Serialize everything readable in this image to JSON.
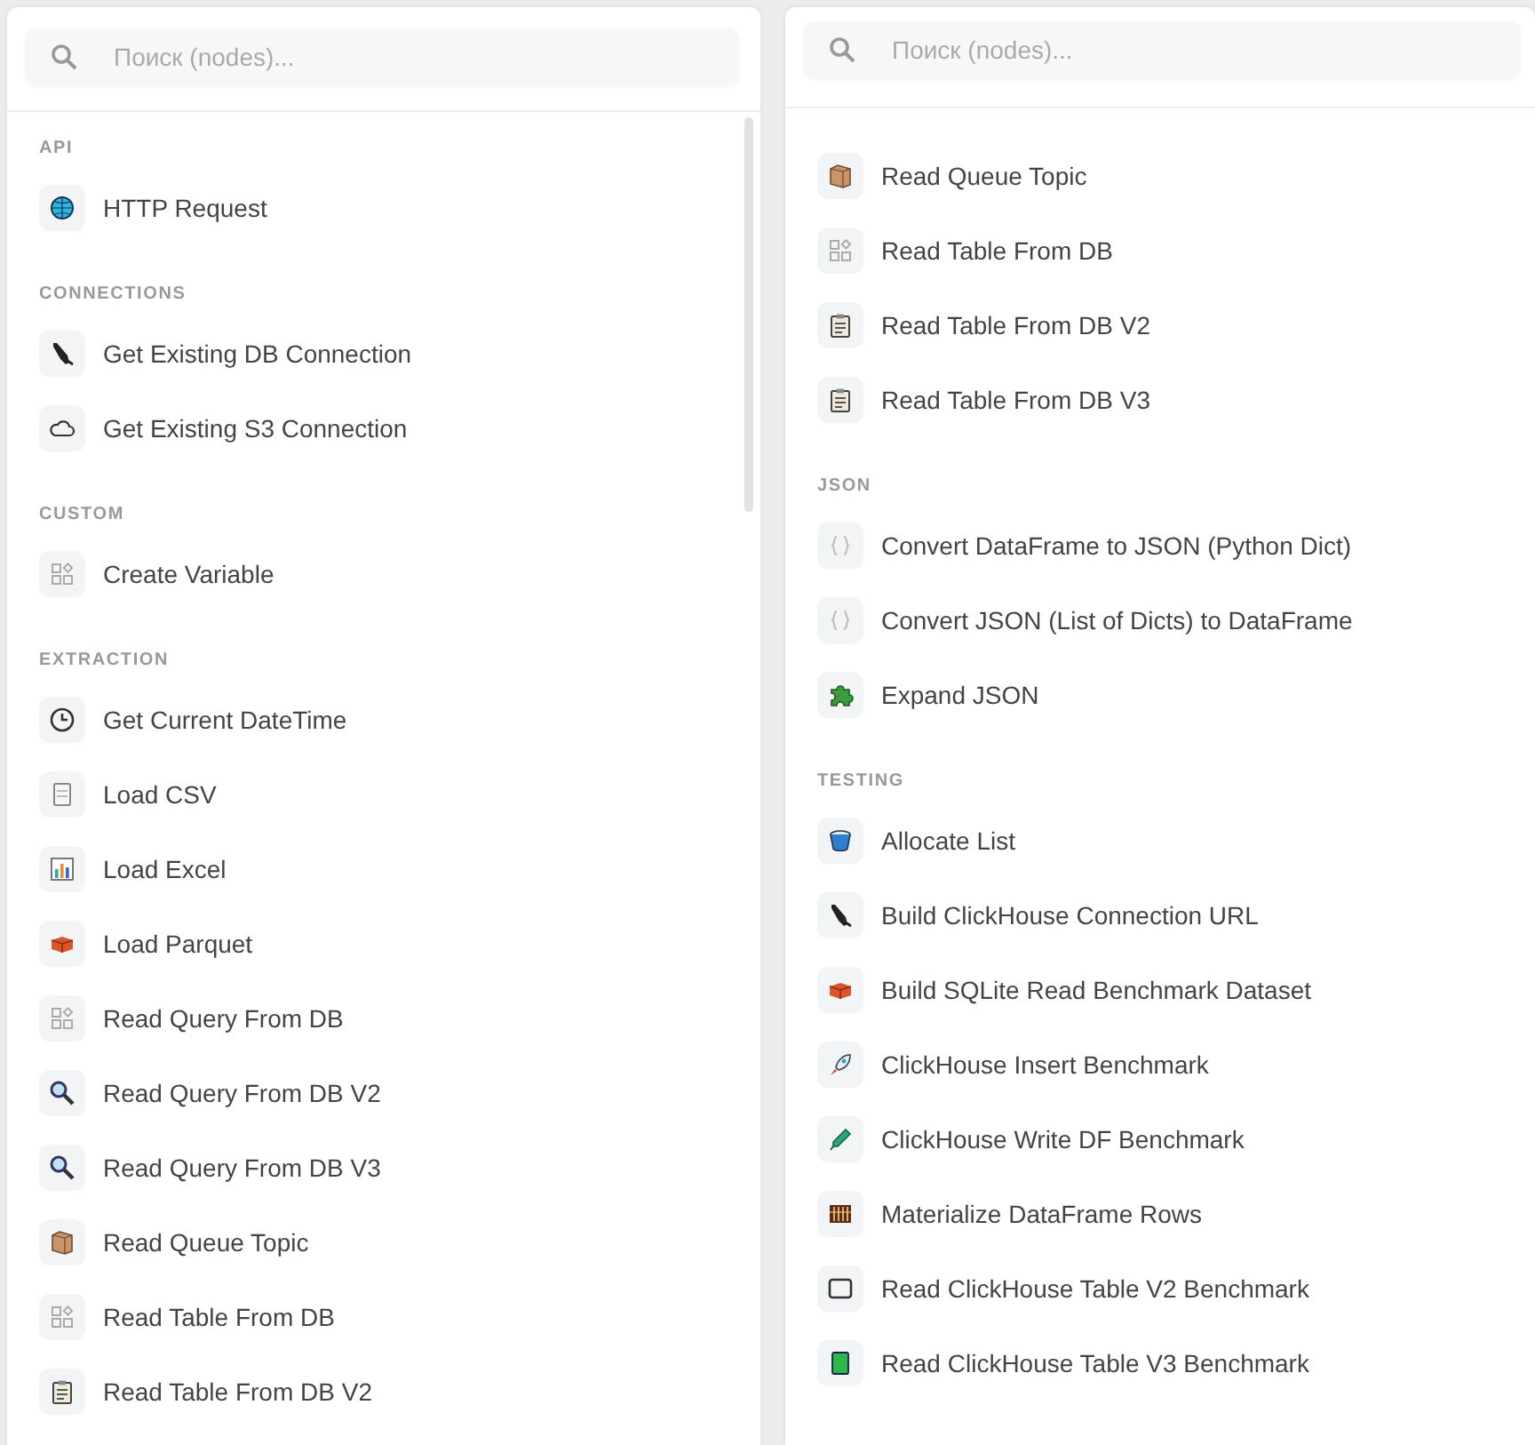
{
  "panels": [
    {
      "search": {
        "placeholder": "Поиск (nodes)..."
      },
      "sections": [
        {
          "title": "API",
          "items": [
            {
              "label": "HTTP Request",
              "kind": "globe"
            }
          ]
        },
        {
          "title": "CONNECTIONS",
          "items": [
            {
              "label": "Get Existing DB Connection",
              "kind": "plug"
            },
            {
              "label": "Get Existing S3 Connection",
              "kind": "cloud"
            }
          ]
        },
        {
          "title": "CUSTOM",
          "items": [
            {
              "label": "Create Variable",
              "kind": "grid"
            }
          ]
        },
        {
          "title": "EXTRACTION",
          "items": [
            {
              "label": "Get Current DateTime",
              "kind": "clock"
            },
            {
              "label": "Load CSV",
              "kind": "doc"
            },
            {
              "label": "Load Excel",
              "kind": "chart"
            },
            {
              "label": "Load Parquet",
              "kind": "brick"
            },
            {
              "label": "Read Query From DB",
              "kind": "grid"
            },
            {
              "label": "Read Query From DB V2",
              "kind": "magnifier"
            },
            {
              "label": "Read Query From DB V3",
              "kind": "magnifier"
            },
            {
              "label": "Read Queue Topic",
              "kind": "box"
            },
            {
              "label": "Read Table From DB",
              "kind": "grid"
            },
            {
              "label": "Read Table From DB V2",
              "kind": "clipboard"
            }
          ]
        }
      ]
    },
    {
      "search": {
        "placeholder": "Поиск (nodes)..."
      },
      "sections": [
        {
          "items": [
            {
              "label": "Read Queue Topic",
              "kind": "box"
            },
            {
              "label": "Read Table From DB",
              "kind": "grid"
            },
            {
              "label": "Read Table From DB V2",
              "kind": "clipboard"
            },
            {
              "label": "Read Table From DB V3",
              "kind": "clipboard"
            }
          ]
        },
        {
          "title": "JSON",
          "items": [
            {
              "label": "Convert DataFrame to JSON (Python Dict)",
              "kind": "braces"
            },
            {
              "label": "Convert JSON (List of Dicts) to DataFrame",
              "kind": "braces"
            },
            {
              "label": "Expand JSON",
              "kind": "puzzle"
            }
          ]
        },
        {
          "title": "TESTING",
          "items": [
            {
              "label": "Allocate List",
              "kind": "bucket"
            },
            {
              "label": "Build ClickHouse Connection URL",
              "kind": "plug"
            },
            {
              "label": "Build SQLite Read Benchmark Dataset",
              "kind": "brick"
            },
            {
              "label": "ClickHouse Insert Benchmark",
              "kind": "rocket"
            },
            {
              "label": "ClickHouse Write DF Benchmark",
              "kind": "pen"
            },
            {
              "label": "Materialize DataFrame Rows",
              "kind": "abacus"
            },
            {
              "label": "Read ClickHouse Table V2 Benchmark",
              "kind": "frame"
            },
            {
              "label": "Read ClickHouse Table V3 Benchmark",
              "kind": "book"
            }
          ]
        }
      ]
    }
  ]
}
